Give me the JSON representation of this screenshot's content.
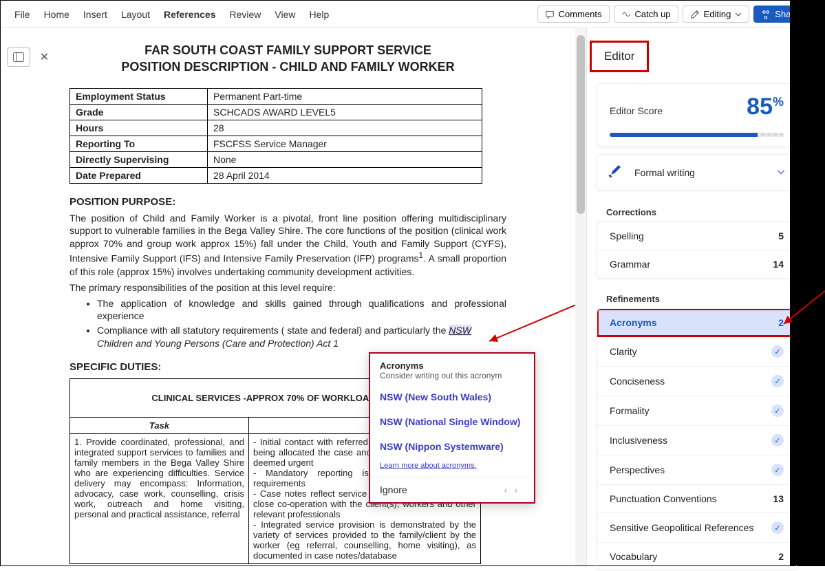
{
  "menu": {
    "items": [
      "File",
      "Home",
      "Insert",
      "Layout",
      "References",
      "Review",
      "View",
      "Help"
    ],
    "active_index": 4,
    "comments": "Comments",
    "catchup": "Catch up",
    "editing": "Editing",
    "share": "Share"
  },
  "doc": {
    "title_line1": "FAR SOUTH COAST FAMILY SUPPORT SERVICE",
    "title_line2": "POSITION DESCRIPTION - CHILD AND FAMILY WORKER",
    "info_table": [
      {
        "label": "Employment Status",
        "value": "Permanent Part-time"
      },
      {
        "label": "Grade",
        "value": "SCHCADS AWARD LEVEL5"
      },
      {
        "label": "Hours",
        "value": "28"
      },
      {
        "label": "Reporting To",
        "value": "FSCFSS Service Manager"
      },
      {
        "label": "Directly Supervising",
        "value": "None"
      },
      {
        "label": "Date Prepared",
        "value": "28 April 2014"
      }
    ],
    "purpose_heading": "POSITION PURPOSE:",
    "purpose_para": "The position of Child and Family Worker is a pivotal, front line position offering multidisciplinary support to vulnerable families in the Bega Valley Shire. The core functions of the position (clinical work approx 70% and group work approx 15%) fall under the Child, Youth and Family Support (CYFS), Intensive Family Support (IFS) and Intensive Family Preservation (IFP) programs",
    "purpose_footnote": "1",
    "purpose_para_tail": ". A small proportion of this role (approx 15%) involves undertaking community development activities.",
    "responsibilities_line": "The primary responsibilities of the position at this level require:",
    "bullets": [
      "The application of knowledge and skills gained through qualifications and professional experience",
      {
        "pre": "Compliance with all statutory requirements ( state and federal)  and particularly the ",
        "mark": "NSW",
        "post_italic": "Children and Young Persons (Care and Protection) Act 1"
      }
    ],
    "duties_heading": "SPECIFIC DUTIES:",
    "duties_table": {
      "header": "CLINICAL SERVICES  -APPROX 70% OF WORKLOAD (also",
      "task_header": "Task",
      "left": "1. Provide coordinated, professional, and integrated support services to families and family members in the Bega Valley Shire who are experiencing difficulties. Service delivery may encompass: Information, advocacy, case work, counselling, crisis work, outreach and home visiting, personal and practical assistance, referral",
      "right": "- Initial contact with referred parties within 24 hours of being allocated the case and 30 minutes if that task is deemed urgent\n- Mandatory reporting is consistent with policy requirements\n- Case notes reflect service planning is coordinated in close co-operation with the client(s), workers and other relevant professionals\n- Integrated service provision is demonstrated by the variety of services provided to the family/client by the worker (eg referral, counselling, home visiting), as documented in case notes/database"
    }
  },
  "popup": {
    "title": "Acronyms",
    "subtitle": "Consider writing out this acronym",
    "options": [
      "NSW (New South Wales)",
      "NSW (National Single Window)",
      "NSW (Nippon Systemware)"
    ],
    "learn": "Learn more about acronyms.",
    "ignore": "Ignore"
  },
  "editor": {
    "title": "Editor",
    "score_label": "Editor Score",
    "score_value": "85",
    "writing_label": "Formal writing",
    "corrections_label": "Corrections",
    "corrections": [
      {
        "name": "Spelling",
        "count": "5"
      },
      {
        "name": "Grammar",
        "count": "14"
      }
    ],
    "refinements_label": "Refinements",
    "refinements": [
      {
        "name": "Acronyms",
        "count": "2",
        "highlight": true
      },
      {
        "name": "Clarity",
        "check": true
      },
      {
        "name": "Conciseness",
        "check": true
      },
      {
        "name": "Formality",
        "check": true
      },
      {
        "name": "Inclusiveness",
        "check": true
      },
      {
        "name": "Perspectives",
        "check": true
      },
      {
        "name": "Punctuation Conventions",
        "count": "13"
      },
      {
        "name": "Sensitive Geopolitical References",
        "check": true
      },
      {
        "name": "Vocabulary",
        "count": "2"
      }
    ]
  }
}
